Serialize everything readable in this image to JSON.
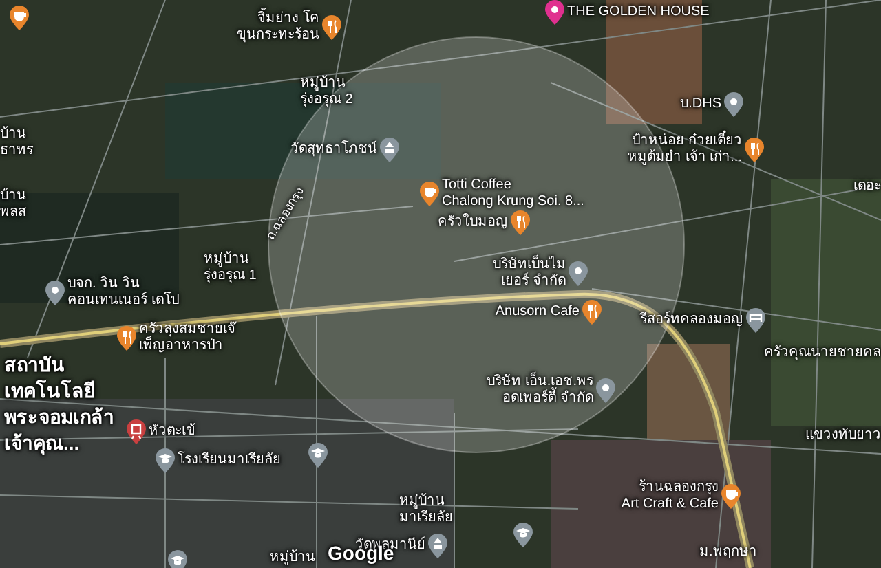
{
  "places": [
    {
      "lines": [
        "จิ้มย่าง โค",
        "ขุนกระทะร้อน"
      ],
      "kind": "restaurant"
    },
    {
      "lines": [
        "THE GOLDEN HOUSE"
      ],
      "kind": "landmark"
    },
    {
      "lines": [
        "หมู่บ้าน",
        "รุ่งอรุณ 2"
      ],
      "kind": "label"
    },
    {
      "lines": [
        "บ้าน",
        "ธาทร"
      ],
      "kind": "label"
    },
    {
      "lines": [
        "วัดสุทธาโภชน์"
      ],
      "kind": "temple"
    },
    {
      "lines": [
        "บ้าน",
        "พลส"
      ],
      "kind": "label"
    },
    {
      "lines": [
        "Totti Coffee",
        "Chalong Krung Soi. 8..."
      ],
      "kind": "cafe"
    },
    {
      "lines": [
        "บ.DHS"
      ],
      "kind": "place"
    },
    {
      "lines": [
        "ป้าหน่อย ก๋วยเตี๋ยว",
        "หมูต้มยำ เจ้า เก่า..."
      ],
      "kind": "restaurant"
    },
    {
      "lines": [
        "เดอะ"
      ],
      "kind": "label"
    },
    {
      "lines": [
        "ครัวใบมอญ"
      ],
      "kind": "restaurant"
    },
    {
      "lines": [
        "ถ.ฉลองกรุง"
      ],
      "kind": "road"
    },
    {
      "lines": [
        "หมู่บ้าน",
        "รุ่งอรุณ 1"
      ],
      "kind": "label"
    },
    {
      "lines": [
        "บริษัทเบ็นไม",
        "เยอร์ จำกัด"
      ],
      "kind": "place"
    },
    {
      "lines": [
        "บจก. วิน วิน",
        "คอนเทนเนอร์ เดโป"
      ],
      "kind": "place"
    },
    {
      "lines": [
        "Anusorn Cafe"
      ],
      "kind": "restaurant"
    },
    {
      "lines": [
        "รีสอร์ทคลองมอญ"
      ],
      "kind": "hotel"
    },
    {
      "lines": [
        "ครัวลุงสมชายเจ๊",
        "เพ็ญอาหารป่า"
      ],
      "kind": "restaurant"
    },
    {
      "lines": [
        "ครัวคุณนายชายคล"
      ],
      "kind": "label"
    },
    {
      "lines": [
        "สถาบัน",
        "เทคโนโลยี",
        "พระจอมเกล้า",
        "เจ้าคุณ..."
      ],
      "kind": "area"
    },
    {
      "lines": [
        "บริษัท เอ็น.เอช.พร",
        "อดเพอร์ตี้ จำกัด"
      ],
      "kind": "place"
    },
    {
      "lines": [
        "หัวตะเข้"
      ],
      "kind": "station"
    },
    {
      "lines": [
        "แขวงทับยาว"
      ],
      "kind": "label"
    },
    {
      "lines": [
        "โรงเรียนมาเรียลัย"
      ],
      "kind": "school"
    },
    {
      "lines": [
        "ร้านฉลองกรุง",
        "Art Craft & Cafe"
      ],
      "kind": "cafe"
    },
    {
      "lines": [
        "หมู่บ้าน",
        "มาเรียลัย"
      ],
      "kind": "label"
    },
    {
      "lines": [
        "วัดพลมานีย์"
      ],
      "kind": "temple"
    },
    {
      "lines": [
        "หมู่บ้าน"
      ],
      "kind": "label"
    },
    {
      "lines": [
        "ม.พฤกษา"
      ],
      "kind": "label"
    }
  ],
  "markers": [
    {
      "kind": "cafe"
    },
    {
      "kind": "school"
    },
    {
      "kind": "school"
    },
    {
      "kind": "school"
    }
  ],
  "logo": "Google"
}
